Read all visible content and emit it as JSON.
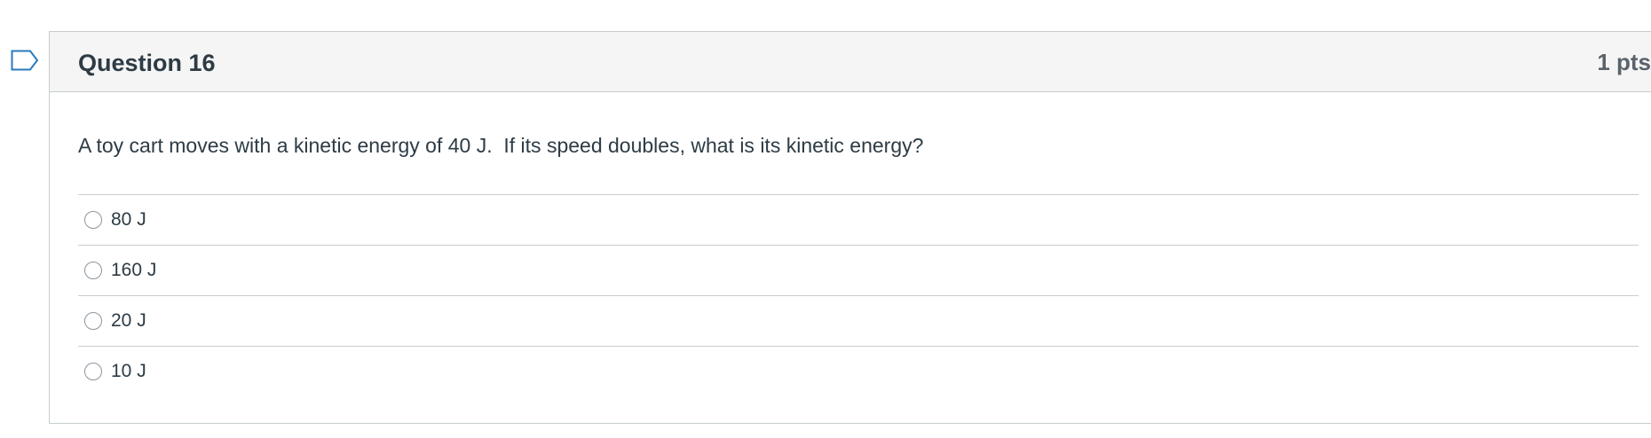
{
  "question": {
    "title": "Question 16",
    "points": "1 pts",
    "text": "A toy cart moves with a kinetic energy of 40 J.  If its speed doubles, what is its kinetic energy?",
    "flag_icon": "flag-icon",
    "answers": [
      {
        "label": "80 J",
        "selected": false
      },
      {
        "label": "160 J",
        "selected": false
      },
      {
        "label": "20 J",
        "selected": false
      },
      {
        "label": "10 J",
        "selected": false
      }
    ]
  },
  "colors": {
    "header_bg": "#f5f5f5",
    "border": "#c7cdd1",
    "text": "#2d3b45",
    "flag": "#2b7abc"
  }
}
